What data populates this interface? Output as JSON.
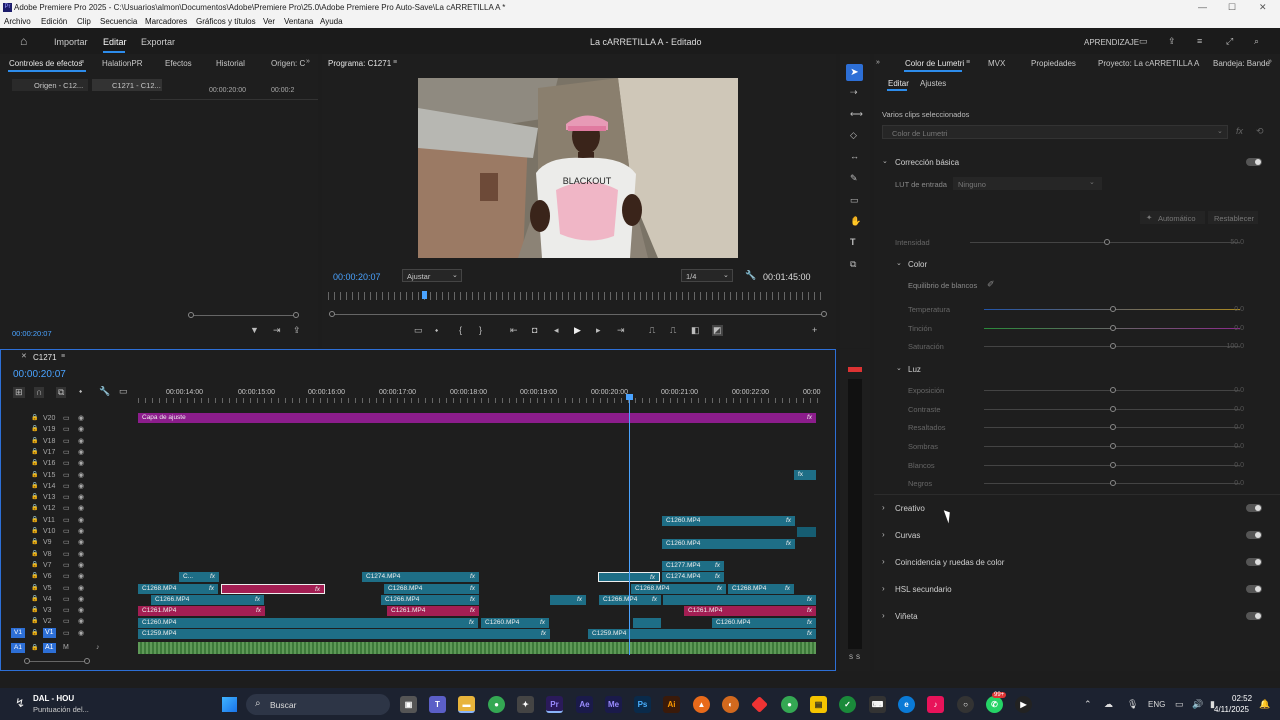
{
  "titlebar": {
    "title": "Adobe Premiere Pro 2025 - C:\\Usuarios\\almon\\Documentos\\Adobe\\Premiere Pro\\25.0\\Adobe Premiere Pro Auto-Save\\La cARRETILLA A *"
  },
  "menu": [
    "Archivo",
    "Edición",
    "Clip",
    "Secuencia",
    "Marcadores",
    "Gráficos y títulos",
    "Ver",
    "Ventana",
    "Ayuda"
  ],
  "appbar": {
    "import": "Importar",
    "edit": "Editar",
    "export": "Exportar",
    "project_title": "La cARRETILLA A - Editado",
    "learn": "APRENDIZAJE"
  },
  "source_panel": {
    "tabs": [
      "Controles de efectos",
      "HalationPR",
      "Efectos",
      "Historial",
      "Origen: C"
    ],
    "subtabs": [
      "Origen - C12...",
      "C1271 - C12..."
    ],
    "tc1": "00:00:20:00",
    "tc2": "00:00:2",
    "timecode": "00:00:20:07"
  },
  "program": {
    "title": "Programa: C1271",
    "timecode": "00:00:20:07",
    "fit": "Ajustar",
    "res": "1/4",
    "duration": "00:01:45:00",
    "shirt_text": "BLACKOUT"
  },
  "timeline": {
    "title": "C1271",
    "timecode": "00:00:20:07",
    "ruler": [
      "00:00:14:00",
      "00:00:15:00",
      "00:00:16:00",
      "00:00:17:00",
      "00:00:18:00",
      "00:00:19:00",
      "00:00:20:00",
      "00:00:21:00",
      "00:00:22:00",
      "00:00"
    ],
    "tracks": [
      "V20",
      "V19",
      "V18",
      "V17",
      "V16",
      "V15",
      "V14",
      "V13",
      "V12",
      "V11",
      "V10",
      "V9",
      "V8",
      "V7",
      "V6",
      "V5",
      "V4",
      "V3",
      "V2",
      "V1"
    ],
    "v1_src": "V1",
    "a1": "A1",
    "a1_src": "A1",
    "clips": {
      "adjust": "Capa de ajuste",
      "c1260": "C1260.MP4",
      "c1277": "C1277.MP4",
      "c1274": "C1274.MP4",
      "c1268": "C1268.MP4",
      "c1266": "C1266.MP4",
      "c1261": "C1261.MP4",
      "c1259": "C1259.MP4",
      "c_short": "C...",
      "fx": "fx"
    }
  },
  "meter": {
    "labels": [
      "S",
      "S"
    ]
  },
  "lumetri": {
    "tabs": [
      "Color de Lumetri",
      "MVX",
      "Propiedades",
      "Proyecto: La cARRETILLA A",
      "Bandeja: Bande"
    ],
    "subtabs": [
      "Editar",
      "Ajustes"
    ],
    "multi": "Varios clips seleccionados",
    "dropdown": "Color de Lumetri",
    "basic": "Corrección básica",
    "lut_label": "LUT de entrada",
    "lut_value": "Ninguno",
    "auto": "Automático",
    "reset": "Restablecer",
    "intensity": "Intensidad",
    "intensity_val": "50.0",
    "color": "Color",
    "wb": "Equilibrio de blancos",
    "temp": "Temperatura",
    "temp_val": "0.0",
    "tint": "Tinción",
    "tint_val": "0.0",
    "sat": "Saturación",
    "sat_val": "100.0",
    "light": "Luz",
    "exp": "Exposición",
    "exp_val": "0.0",
    "contrast": "Contraste",
    "contrast_val": "0.0",
    "highlights": "Resaltados",
    "highlights_val": "0.0",
    "shadows": "Sombras",
    "shadows_val": "0.0",
    "whites": "Blancos",
    "whites_val": "0.0",
    "blacks": "Negros",
    "blacks_val": "0.0",
    "creative": "Creativo",
    "curves": "Curvas",
    "match": "Coincidencia y ruedas de color",
    "hsl": "HSL secundario",
    "vignette": "Viñeta"
  },
  "taskbar": {
    "stock_name": "DAL - HOU",
    "stock_sub": "Puntuación del...",
    "search": "Buscar",
    "lang": "ENG",
    "time": "02:52",
    "date": "4/11/2025",
    "badge": "99+"
  },
  "colors": {
    "accent": "#2d8ceb",
    "adjust_clip": "#8c1d8c",
    "teal_clip": "#1e6e86",
    "pink_clip": "#a31e53",
    "audio": "#4d8a4a"
  }
}
